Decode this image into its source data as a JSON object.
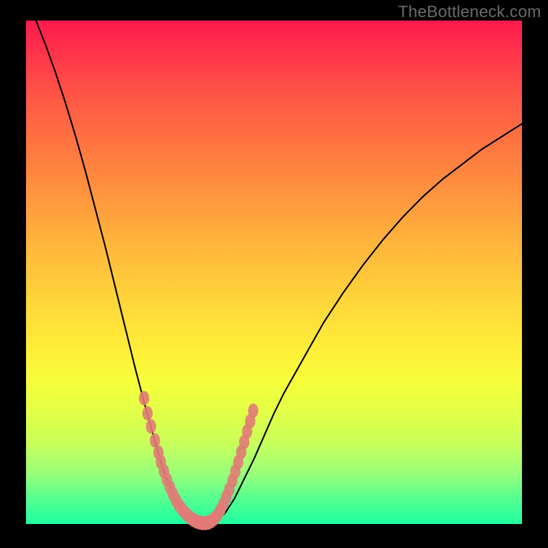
{
  "watermark": "TheBottleneck.com",
  "colors": {
    "background": "#000000",
    "watermark": "#6a6a6a",
    "curve": "#000000",
    "marker": "#e17b77",
    "gradient_stops": [
      "#ff1a4d",
      "#ff3a4a",
      "#ff5a45",
      "#ff7940",
      "#ff9a3e",
      "#ffba3c",
      "#ffd63a",
      "#fff039",
      "#f6ff3a",
      "#e0ff48",
      "#c8ff5a",
      "#99ff7a",
      "#55ff90",
      "#1effa0"
    ]
  },
  "chart_data": {
    "type": "line",
    "title": "",
    "xlabel": "",
    "ylabel": "",
    "xlim": [
      0,
      100
    ],
    "ylim": [
      0,
      100
    ],
    "x": [
      2,
      4,
      6,
      8,
      10,
      12,
      14,
      16,
      18,
      20,
      22,
      24,
      26,
      27,
      28,
      29,
      30,
      31,
      32,
      33,
      34,
      35,
      36,
      38,
      40,
      42,
      44,
      46,
      48,
      50,
      52,
      56,
      60,
      64,
      68,
      72,
      76,
      80,
      84,
      88,
      92,
      96,
      100
    ],
    "values": [
      100,
      95,
      89.5,
      83.5,
      77,
      70,
      62.5,
      55,
      47,
      39,
      31,
      23.5,
      16.5,
      13,
      10,
      7.5,
      5.5,
      3.8,
      2.5,
      1.5,
      0.8,
      0.3,
      0.1,
      0.5,
      2,
      5,
      9,
      13,
      17.5,
      22,
      26,
      33,
      40,
      46,
      51.5,
      56.5,
      61,
      65,
      68.5,
      71.5,
      74.5,
      77,
      79.5
    ],
    "markers": {
      "x": [
        23.8,
        24.5,
        25.2,
        26.0,
        26.7,
        27.2,
        27.8,
        28.4,
        29.0,
        29.6,
        30.2,
        30.8,
        31.4,
        32.0,
        32.6,
        33.2,
        33.8,
        34.4,
        35.0,
        35.6,
        36.2,
        36.8,
        37.4,
        38.0,
        38.6,
        39.2,
        39.8,
        40.4,
        41.0,
        41.6,
        42.2,
        42.8,
        43.4,
        44.0,
        44.6,
        45.2,
        45.8
      ],
      "y": [
        25.0,
        22.0,
        19.4,
        16.6,
        14.2,
        12.3,
        10.5,
        8.8,
        7.3,
        6.0,
        4.8,
        3.8,
        3.0,
        2.3,
        1.7,
        1.2,
        0.8,
        0.5,
        0.3,
        0.2,
        0.2,
        0.3,
        0.6,
        1.1,
        1.8,
        2.8,
        4.0,
        5.4,
        6.9,
        8.6,
        10.4,
        12.3,
        14.3,
        16.3,
        18.4,
        20.4,
        22.5
      ]
    }
  }
}
